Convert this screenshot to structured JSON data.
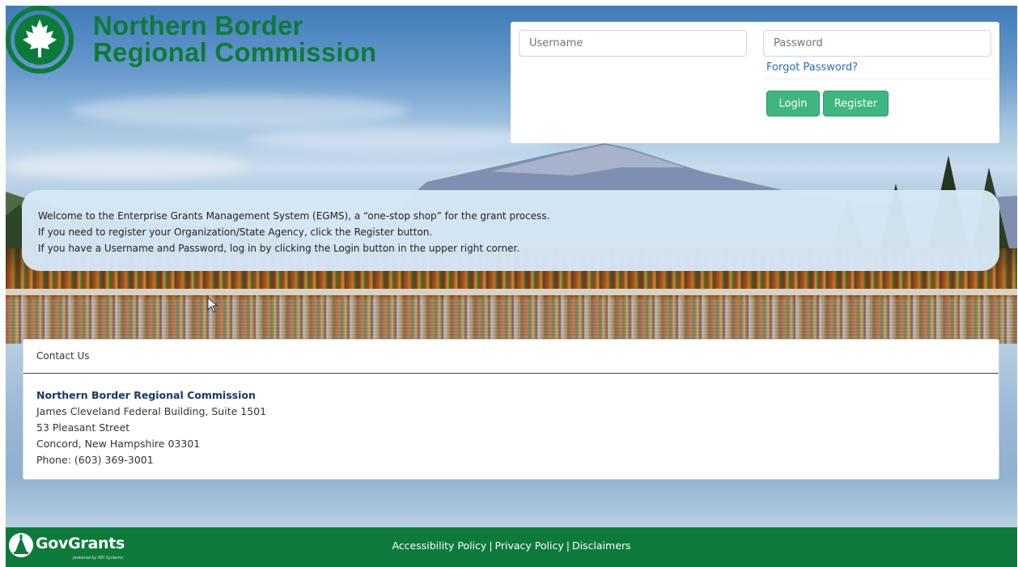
{
  "brand": {
    "title_line1": "Northern Border",
    "title_line2": "Regional Commission",
    "color": "#0e7a3a"
  },
  "login": {
    "username_placeholder": "Username",
    "password_placeholder": "Password",
    "forgot_label": "Forgot Password?",
    "login_label": "Login",
    "register_label": "Register",
    "button_color": "#3fb57f",
    "link_color": "#2a6db0"
  },
  "welcome": {
    "line1": "Welcome to the Enterprise Grants Management System (EGMS), a “one-stop shop” for the grant process.",
    "line2": "If you need to register your Organization/State Agency, click the Register button.",
    "line3": "If you have a Username and Password, log in by clicking the Login button in the upper right corner."
  },
  "contact": {
    "header": "Contact Us",
    "org_name": "Northern Border Regional Commission",
    "address1": "James Cleveland Federal Building, Suite 1501",
    "address2": "53 Pleasant Street",
    "city_state_zip": "Concord, New Hampshire 03301",
    "phone": "Phone: (603) 369-3001"
  },
  "footer": {
    "logo_name": "GovGrants",
    "logo_sub": "powered by REI Systems",
    "links": [
      "Accessibility Policy",
      "Privacy Policy",
      "Disclaimers"
    ],
    "separator": "|",
    "color": "#0d7a3b"
  },
  "icons": {
    "brand_logo": "maple-leaf-icon",
    "footer_logo": "capitol-dome-icon",
    "cursor": "mouse-pointer-icon"
  }
}
